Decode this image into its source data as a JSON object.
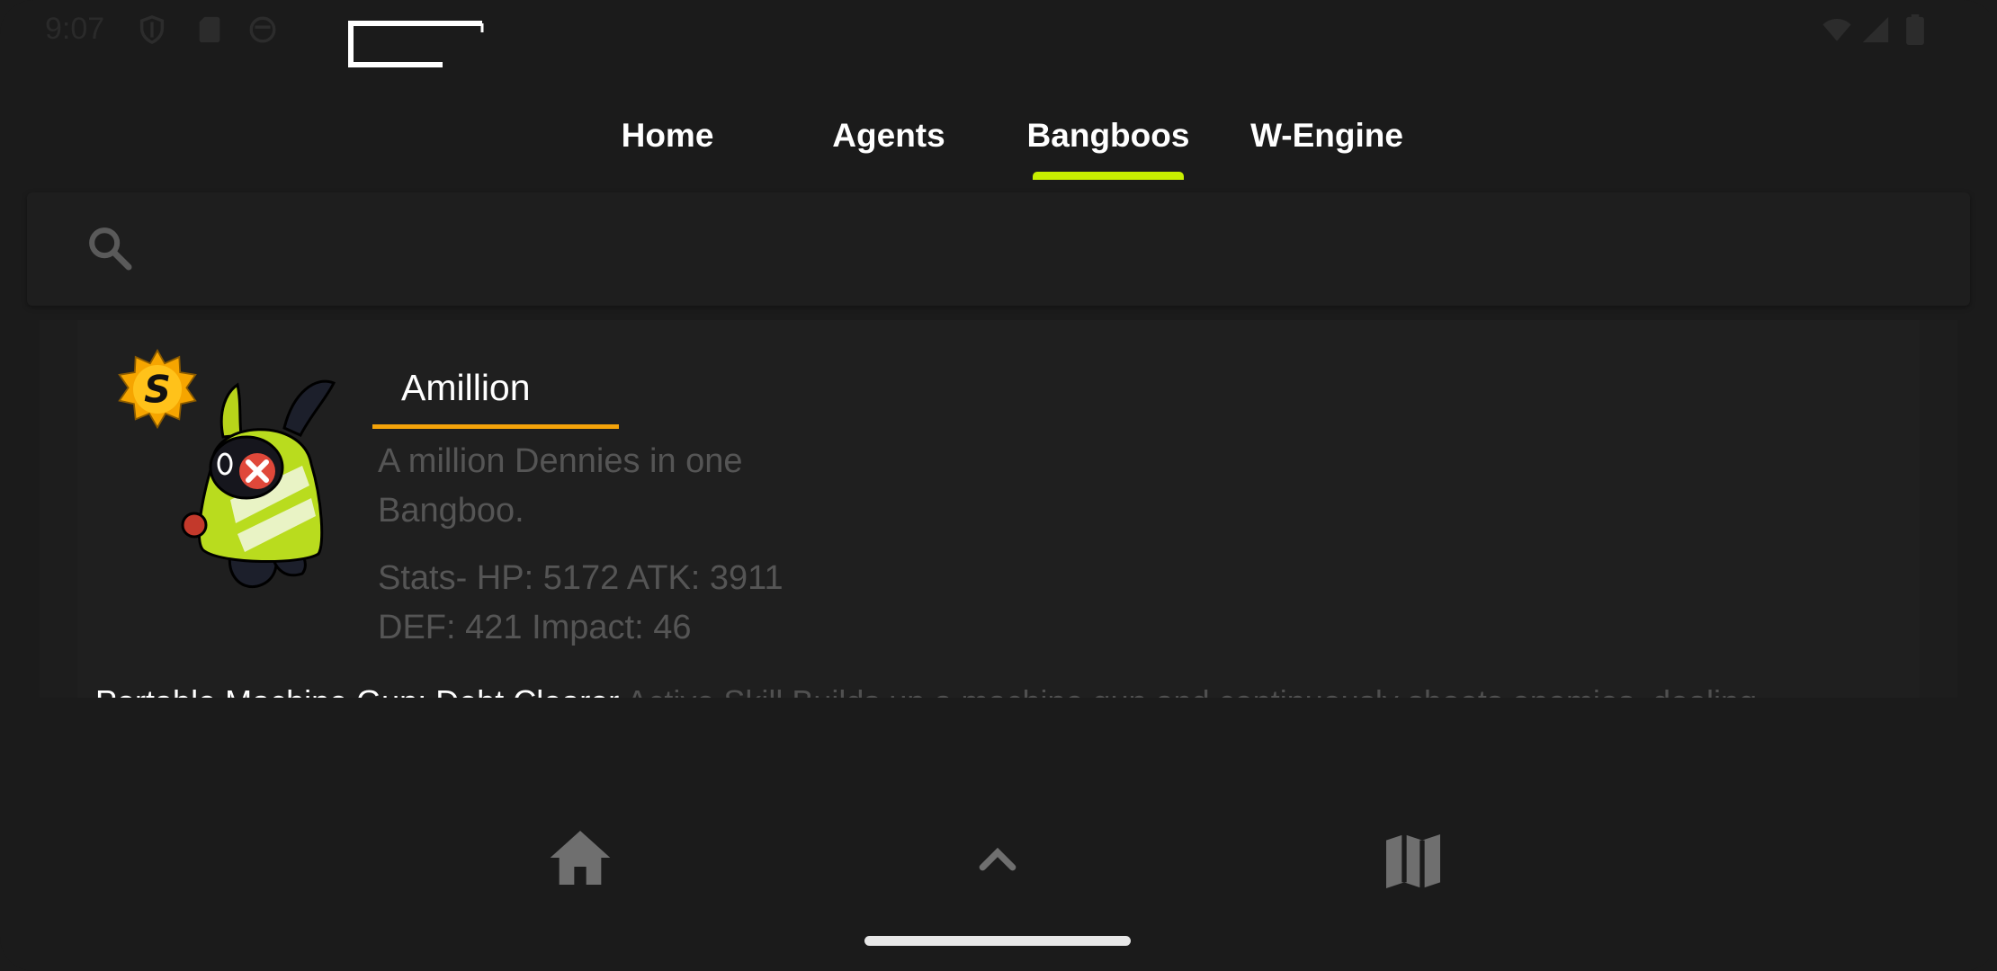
{
  "status_bar": {
    "time": "9:07",
    "left_icons": [
      "shield-icon",
      "sd-card-icon",
      "circle-face-icon"
    ],
    "right_icons": [
      "wifi-icon",
      "signal-icon",
      "battery-icon"
    ]
  },
  "tabs": [
    {
      "label": "Home",
      "selected": false
    },
    {
      "label": "Agents",
      "selected": false
    },
    {
      "label": "Bangboos",
      "selected": true
    },
    {
      "label": "W-Engine",
      "selected": false
    }
  ],
  "colors": {
    "accent": "#c8ef00",
    "name_underline": "#f4a30a",
    "background": "#1b1b1b",
    "muted_text": "#555555"
  },
  "search": {
    "placeholder": "",
    "icon": "search-icon"
  },
  "bangboo": {
    "rank": "S",
    "name": "Amillion",
    "description": "A million Dennies in one Bangboo.",
    "stats_line1": "Stats- HP: 5172  ATK: 3911",
    "stats_line2": "DEF: 421  Impact: 46",
    "skill_name": "Portable Machine Gun: Debt Clearer",
    "skill_desc": " Active Skill Builds up a machine gun and continuously shoots enemies, dealing"
  },
  "bottom_nav": [
    {
      "icon": "home-icon"
    },
    {
      "icon": "chevron-up-icon"
    },
    {
      "icon": "map-icon"
    }
  ]
}
